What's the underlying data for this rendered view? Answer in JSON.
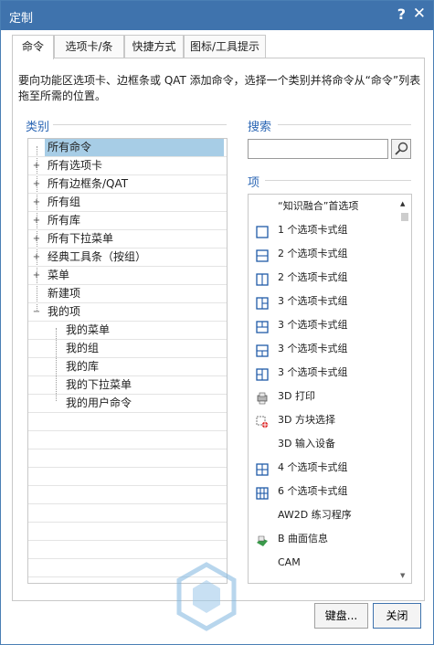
{
  "window": {
    "title": "定制",
    "help_label": "?",
    "close_label": "✕"
  },
  "tabs": [
    {
      "label": "命令",
      "active": true
    },
    {
      "label": "选项卡/条",
      "active": false
    },
    {
      "label": "快捷方式",
      "active": false
    },
    {
      "label": "图标/工具提示",
      "active": false
    }
  ],
  "description": "要向功能区选项卡、边框条或 QAT 添加命令，选择一个类别并将命令从“命令”列表拖至所需的位置。",
  "categories": {
    "label": "类别",
    "items": [
      {
        "label": "所有命令",
        "expander": "",
        "selected": true
      },
      {
        "label": "所有选项卡",
        "expander": "+",
        "selected": false
      },
      {
        "label": "所有边框条/QAT",
        "expander": "+",
        "selected": false
      },
      {
        "label": "所有组",
        "expander": "+",
        "selected": false
      },
      {
        "label": "所有库",
        "expander": "+",
        "selected": false
      },
      {
        "label": "所有下拉菜单",
        "expander": "+",
        "selected": false
      },
      {
        "label": "经典工具条（按组）",
        "expander": "+",
        "selected": false
      },
      {
        "label": "菜单",
        "expander": "+",
        "selected": false
      },
      {
        "label": "新建项",
        "expander": "",
        "selected": false
      },
      {
        "label": "我的项",
        "expander": "−",
        "selected": false
      },
      {
        "label": "我的菜单",
        "expander": "",
        "selected": false
      },
      {
        "label": "我的组",
        "expander": "",
        "selected": false
      },
      {
        "label": "我的库",
        "expander": "",
        "selected": false
      },
      {
        "label": "我的下拉菜单",
        "expander": "",
        "selected": false
      },
      {
        "label": "我的用户命令",
        "expander": "",
        "selected": false
      }
    ]
  },
  "search": {
    "label": "搜索",
    "value": "",
    "placeholder": ""
  },
  "items": {
    "label": "项",
    "list": [
      {
        "label": "“知识融合”首选项",
        "icon": "none"
      },
      {
        "label": "1 个选项卡式组",
        "icon": "one-tab-group-icon"
      },
      {
        "label": "2 个选项卡式组",
        "icon": "two-tab-horizontal-icon"
      },
      {
        "label": "2 个选项卡式组",
        "icon": "two-tab-vertical-icon"
      },
      {
        "label": "3 个选项卡式组",
        "icon": "three-tab-a-icon"
      },
      {
        "label": "3 个选项卡式组",
        "icon": "three-tab-b-icon"
      },
      {
        "label": "3 个选项卡式组",
        "icon": "three-tab-c-icon"
      },
      {
        "label": "3 个选项卡式组",
        "icon": "three-tab-d-icon"
      },
      {
        "label": "3D 打印",
        "icon": "printer-3d-icon"
      },
      {
        "label": "3D 方块选择",
        "icon": "block-select-icon"
      },
      {
        "label": "3D 输入设备",
        "icon": "none"
      },
      {
        "label": "4 个选项卡式组",
        "icon": "four-tab-group-icon"
      },
      {
        "label": "6 个选项卡式组",
        "icon": "six-tab-group-icon"
      },
      {
        "label": "AW2D 练习程序",
        "icon": "none"
      },
      {
        "label": "B 曲面信息",
        "icon": "surface-info-icon"
      },
      {
        "label": "CAM",
        "icon": "none"
      }
    ]
  },
  "buttons": {
    "keyboard": "键盘...",
    "close": "关闭"
  },
  "colors": {
    "titlebar": "#3f73ad",
    "section_label": "#2c67b5",
    "selection": "#a7cde6",
    "icon_blue": "#1f5aa8"
  }
}
